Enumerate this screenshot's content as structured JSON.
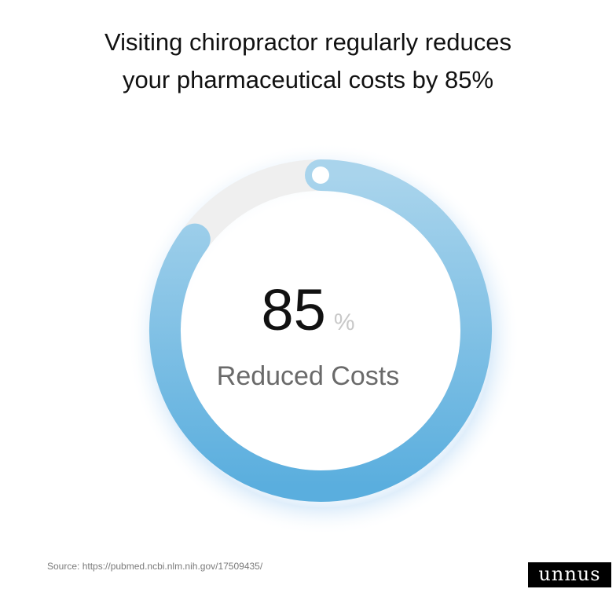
{
  "title": {
    "line1": "Visiting chiropractor regularly reduces",
    "line2": "your pharmaceutical costs by 85%"
  },
  "chart_data": {
    "type": "donut",
    "value": 85,
    "max": 100,
    "unit": "%",
    "label": "Reduced Costs",
    "colors": {
      "progress_start": "#a9d4ec",
      "progress_end": "#5aaede",
      "track": "#efefef"
    }
  },
  "footer": {
    "source": "Source: https://pubmed.ncbi.nlm.nih.gov/17509435/",
    "logo": "unnus"
  }
}
